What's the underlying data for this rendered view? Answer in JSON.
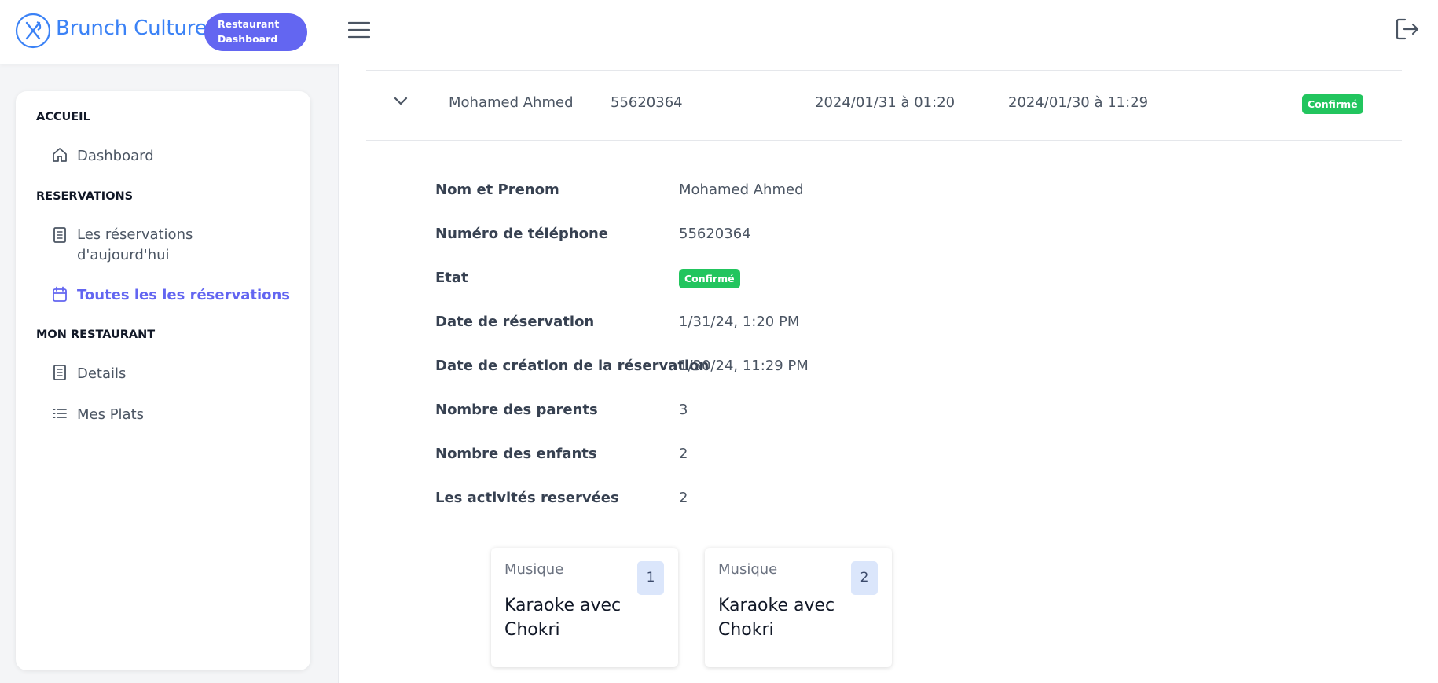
{
  "header": {
    "brand_name": "Brunch Culturel",
    "pill_line1": "Restaurant",
    "pill_line2": "Dashboard",
    "accent_color": "#3b82f6",
    "pill_color": "#6366f1",
    "menu_icon": "hamburger-icon",
    "logout_icon": "logout-icon"
  },
  "sidebar": {
    "sections": [
      {
        "title": "ACCUEIL"
      },
      {
        "title": "RESERVATIONS"
      },
      {
        "title": "MON RESTAURANT"
      }
    ],
    "items": [
      {
        "label": "Dashboard",
        "icon": "home-icon"
      },
      {
        "label": "Les réservations d'aujourd'hui",
        "icon": "document-icon"
      },
      {
        "label": "Toutes les les réservations",
        "icon": "calendar-icon",
        "active": true
      },
      {
        "label": "Details",
        "icon": "document-icon"
      },
      {
        "label": "Mes Plats",
        "icon": "list-icon"
      }
    ],
    "active_color": "#6366f1"
  },
  "reservation": {
    "name": "Mohamed Ahmed",
    "phone": "55620364",
    "reservation_date": "2024/01/31 à 01:20",
    "created_date": "2024/01/30 à 11:29",
    "status": "Confirmé",
    "status_color": "#22c55e"
  },
  "details": {
    "rows": [
      {
        "label": "Nom et Prenom",
        "value": "Mohamed Ahmed"
      },
      {
        "label": "Numéro de téléphone",
        "value": "55620364"
      },
      {
        "label": "Etat",
        "value": "Confirmé"
      },
      {
        "label": "Date de réservation",
        "value": "1/31/24, 1:20 PM"
      },
      {
        "label": "Date de création de la réservation",
        "value": "1/30/24, 11:29 PM"
      },
      {
        "label": "Nombre des parents",
        "value": "3"
      },
      {
        "label": "Nombre des enfants",
        "value": "2"
      },
      {
        "label": "Les activités reservées",
        "value": "2"
      }
    ]
  },
  "activities": [
    {
      "category": "Musique",
      "number": "1",
      "name": "Karaoke avec Chokri"
    },
    {
      "category": "Musique",
      "number": "2",
      "name": "Karaoke avec Chokri"
    }
  ]
}
